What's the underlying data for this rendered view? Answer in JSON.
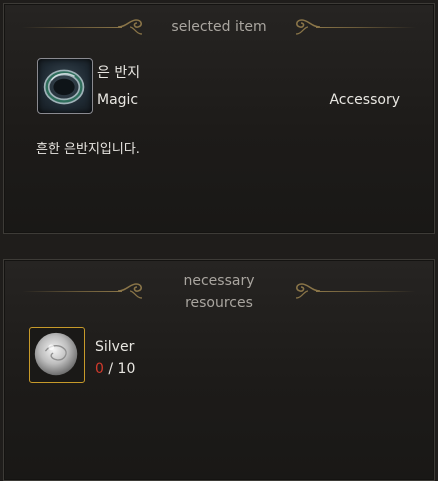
{
  "selected_panel": {
    "title": "selected item",
    "item": {
      "name": "은 반지",
      "grade": "Magic",
      "type": "Accessory",
      "description": "흔한 은반지입니다.",
      "icon": "silver-ring-icon"
    }
  },
  "resources_panel": {
    "title_line1": "necessary",
    "title_line2": "resources",
    "resources": [
      {
        "name": "Silver",
        "have": "0",
        "separator": " / ",
        "need": "10",
        "icon": "silver-ore-icon"
      }
    ]
  },
  "colors": {
    "ornament": "#8a7548",
    "have_insufficient": "#d23a2c",
    "resource_border": "#c79a2a"
  }
}
